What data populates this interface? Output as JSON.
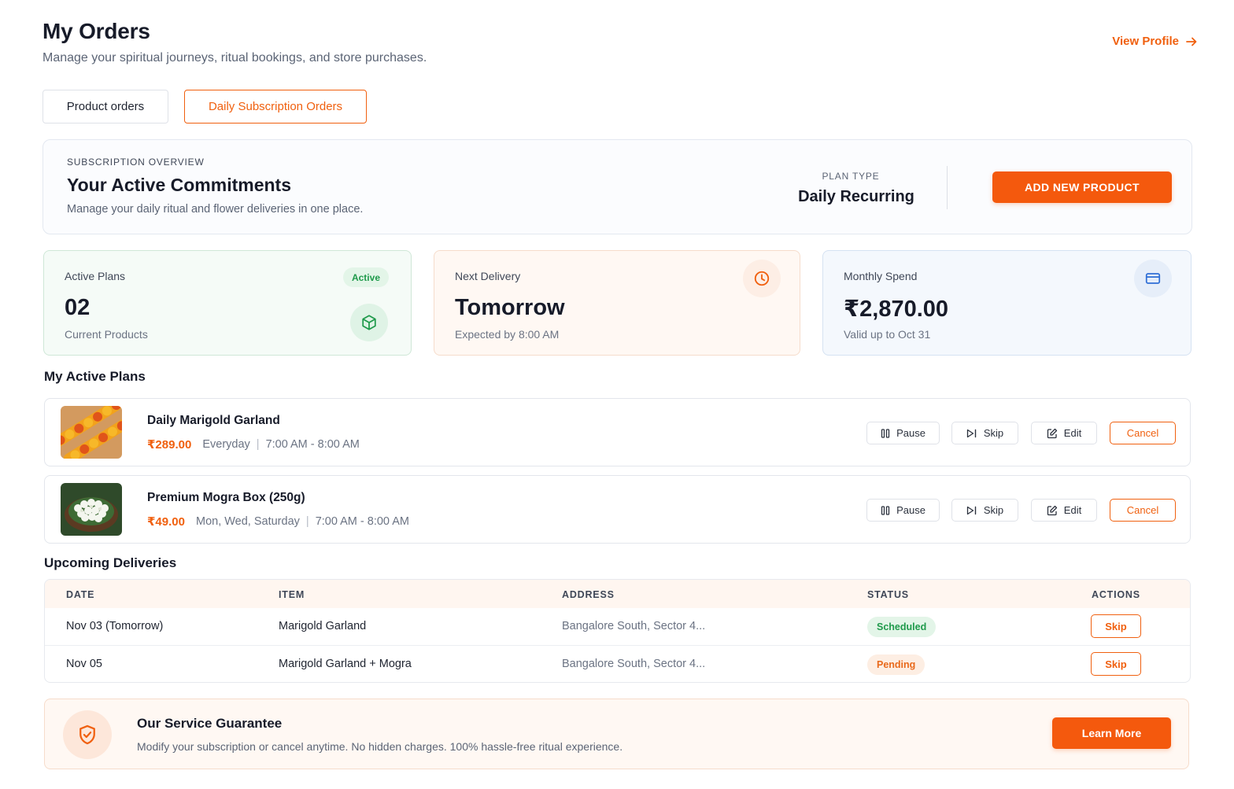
{
  "header": {
    "title": "My Orders",
    "subtitle": "Manage your spiritual journeys, ritual bookings, and store purchases.",
    "view_profile": "View Profile"
  },
  "tabs": [
    {
      "label": "Product orders",
      "active": false
    },
    {
      "label": "Daily Subscription Orders",
      "active": true
    }
  ],
  "overview": {
    "eyebrow": "SUBSCRIPTION OVERVIEW",
    "title": "Your Active Commitments",
    "description": "Manage your daily ritual and flower deliveries in one place.",
    "plan_type_label": "PLAN TYPE",
    "plan_type_value": "Daily Recurring",
    "add_button": "ADD NEW PRODUCT"
  },
  "stats": {
    "active_plans": {
      "label": "Active Plans",
      "badge": "Active",
      "value": "02",
      "sub": "Current Products",
      "icon": "cube-icon"
    },
    "next_delivery": {
      "label": "Next Delivery",
      "value": "Tomorrow",
      "sub": "Expected by 8:00 AM",
      "icon": "clock-icon"
    },
    "monthly_spend": {
      "label": "Monthly Spend",
      "value": "₹2,870.00",
      "sub": "Valid up to Oct 31",
      "icon": "credit-card-icon"
    }
  },
  "active_plans": {
    "heading": "My Active Plans",
    "actions": {
      "pause": "Pause",
      "skip": "Skip",
      "edit": "Edit",
      "cancel": "Cancel"
    },
    "items": [
      {
        "name": "Daily Marigold Garland",
        "price": "₹289.00",
        "schedule": "Everyday",
        "time": "7:00 AM - 8:00 AM",
        "image": "marigold-garland"
      },
      {
        "name": "Premium Mogra Box (250g)",
        "price": "₹49.00",
        "schedule": "Mon, Wed, Saturday",
        "time": "7:00 AM - 8:00 AM",
        "image": "mogra-flowers"
      }
    ]
  },
  "upcoming": {
    "heading": "Upcoming Deliveries",
    "columns": [
      "DATE",
      "ITEM",
      "ADDRESS",
      "STATUS",
      "ACTIONS"
    ],
    "rows": [
      {
        "date": "Nov 03 (Tomorrow)",
        "item": "Marigold Garland",
        "address": "Bangalore South, Sector 4...",
        "status": "Scheduled",
        "action": "Skip"
      },
      {
        "date": "Nov 05",
        "item": "Marigold Garland + Mogra",
        "address": "Bangalore South, Sector 4...",
        "status": "Pending",
        "action": "Skip"
      }
    ]
  },
  "guarantee": {
    "title": "Our Service Guarantee",
    "description": "Modify your subscription or cancel anytime. No hidden charges. 100% hassle-free ritual experience.",
    "button": "Learn More",
    "icon": "shield-check-icon"
  },
  "colors": {
    "accent": "#f4590d",
    "success": "#1f9a4b",
    "pending": "#e96a1c"
  }
}
